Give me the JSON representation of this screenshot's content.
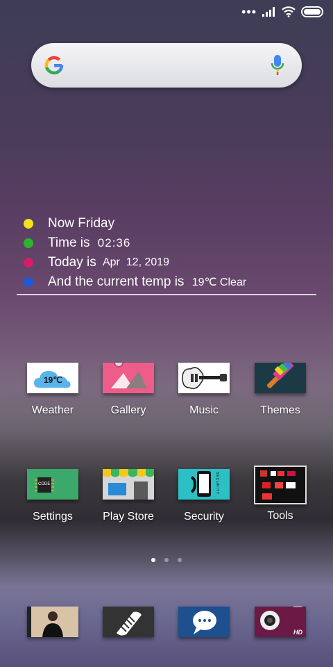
{
  "widget": {
    "lines": [
      {
        "color": "#f2e11b",
        "text": "Now Friday",
        "extra": ""
      },
      {
        "color": "#2db32d",
        "text": "Time is ",
        "extra": "02:36"
      },
      {
        "color": "#d81c67",
        "text": "Today is ",
        "extra": "Apr  12, 2019"
      },
      {
        "color": "#2058d8",
        "text": "And the current temp is ",
        "extra": "19℃ Clear"
      }
    ]
  },
  "apps": {
    "weather": {
      "label": "Weather",
      "temp": "19℃"
    },
    "gallery": {
      "label": "Gallery"
    },
    "music": {
      "label": "Music"
    },
    "themes": {
      "label": "Themes"
    },
    "settings": {
      "label": "Settings",
      "chip": "CODE"
    },
    "playstore": {
      "label": "Play Store"
    },
    "security": {
      "label": "Security",
      "side_text": "SECURITY"
    },
    "tools": {
      "label": "Tools"
    }
  },
  "dock": {
    "camera_badge": "HD"
  },
  "colors": {
    "accent_white": "#ffffff"
  }
}
